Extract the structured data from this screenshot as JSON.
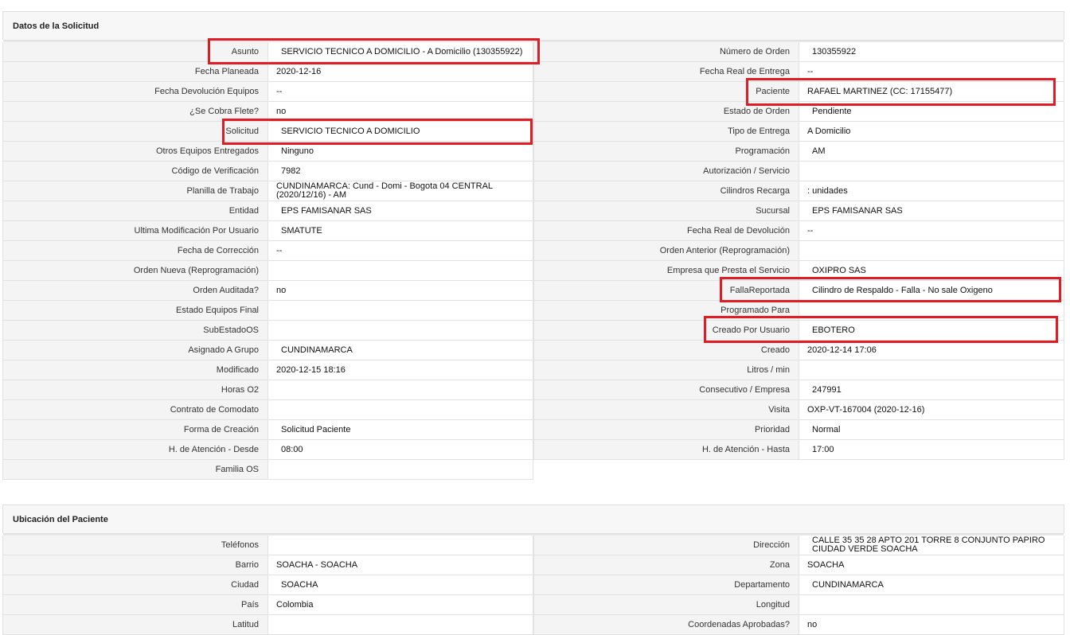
{
  "solicitud": {
    "title": "Datos de la Solicitud",
    "rows": [
      {
        "l_label": "Asunto",
        "l_value": "SERVICIO TECNICO A DOMICILIO - A Domicilio (130355922)",
        "r_label": "Número de Orden",
        "r_value": "130355922"
      },
      {
        "l_label": "Fecha Planeada",
        "l_value": "2020-12-16",
        "r_label": "Fecha Real de Entrega",
        "r_value": "--"
      },
      {
        "l_label": "Fecha Devolución Equipos",
        "l_value": "--",
        "r_label": "Paciente",
        "r_value": "RAFAEL MARTINEZ (CC: 17155477)"
      },
      {
        "l_label": "¿Se Cobra Flete?",
        "l_value": "no",
        "r_label": "Estado de Orden",
        "r_value": "Pendiente"
      },
      {
        "l_label": "Solicitud",
        "l_value": "SERVICIO TECNICO A DOMICILIO",
        "r_label": "Tipo de Entrega",
        "r_value": "A Domicilio"
      },
      {
        "l_label": "Otros Equipos Entregados",
        "l_value": "Ninguno",
        "r_label": "Programación",
        "r_value": "AM"
      },
      {
        "l_label": "Código de Verificación",
        "l_value": "7982",
        "r_label": "Autorización / Servicio",
        "r_value": ""
      },
      {
        "l_label": "Planilla de Trabajo",
        "l_value": "CUNDINAMARCA: Cund - Domi - Bogota 04 CENTRAL (2020/12/16) - AM",
        "r_label": "Cilindros Recarga",
        "r_value": ": unidades"
      },
      {
        "l_label": "Entidad",
        "l_value": "EPS FAMISANAR SAS",
        "r_label": "Sucursal",
        "r_value": "EPS FAMISANAR SAS"
      },
      {
        "l_label": "Ultima Modificación Por Usuario",
        "l_value": "SMATUTE",
        "r_label": "Fecha Real de Devolución",
        "r_value": "--"
      },
      {
        "l_label": "Fecha de Corrección",
        "l_value": "--",
        "r_label": "Orden Anterior (Reprogramación)",
        "r_value": ""
      },
      {
        "l_label": "Orden Nueva (Reprogramación)",
        "l_value": "",
        "r_label": "Empresa que Presta el Servicio",
        "r_value": "OXIPRO SAS"
      },
      {
        "l_label": "Orden Auditada?",
        "l_value": "no",
        "r_label": "FallaReportada",
        "r_value": "Cilindro de Respaldo - Falla - No sale Oxigeno"
      },
      {
        "l_label": "Estado Equipos Final",
        "l_value": "",
        "r_label": "Programado Para",
        "r_value": ""
      },
      {
        "l_label": "SubEstadoOS",
        "l_value": "",
        "r_label": "Creado Por Usuario",
        "r_value": "EBOTERO"
      },
      {
        "l_label": "Asignado A Grupo",
        "l_value": "CUNDINAMARCA",
        "r_label": "Creado",
        "r_value": "2020-12-14 17:06"
      },
      {
        "l_label": "Modificado",
        "l_value": "2020-12-15 18:16",
        "r_label": "Litros / min",
        "r_value": ""
      },
      {
        "l_label": "Horas O2",
        "l_value": "",
        "r_label": "Consecutivo / Empresa",
        "r_value": "247991"
      },
      {
        "l_label": "Contrato de Comodato",
        "l_value": "",
        "r_label": "Visita",
        "r_value": "OXP-VT-167004 (2020-12-16)"
      },
      {
        "l_label": "Forma de Creación",
        "l_value": "Solicitud Paciente",
        "r_label": "Prioridad",
        "r_value": "Normal"
      },
      {
        "l_label": "H. de Atención - Desde",
        "l_value": "08:00",
        "r_label": "H. de Atención - Hasta",
        "r_value": "17:00"
      },
      {
        "l_label": "Familia OS",
        "l_value": ""
      }
    ]
  },
  "ubicacion": {
    "title": "Ubicación del Paciente",
    "rows": [
      {
        "l_label": "Teléfonos",
        "l_value": "",
        "r_label": "Dirección",
        "r_value": "CALLE 35 35 28 APTO 201 TORRE 8 CONJUNTO PAPIRO CIUDAD VERDE SOACHA"
      },
      {
        "l_label": "Barrio",
        "l_value": "SOACHA - SOACHA",
        "r_label": "Zona",
        "r_value": "SOACHA"
      },
      {
        "l_label": "Ciudad",
        "l_value": "SOACHA",
        "r_label": "Departamento",
        "r_value": "CUNDINAMARCA"
      },
      {
        "l_label": "País",
        "l_value": "Colombia",
        "r_label": "Longitud",
        "r_value": ""
      },
      {
        "l_label": "Latitud",
        "l_value": "",
        "r_label": "Coordenadas Aprobadas?",
        "r_value": "no"
      }
    ]
  },
  "colors": {
    "highlight": "#e01c24",
    "label_bg": "#f4f4f4",
    "border": "#e2e2e2"
  }
}
